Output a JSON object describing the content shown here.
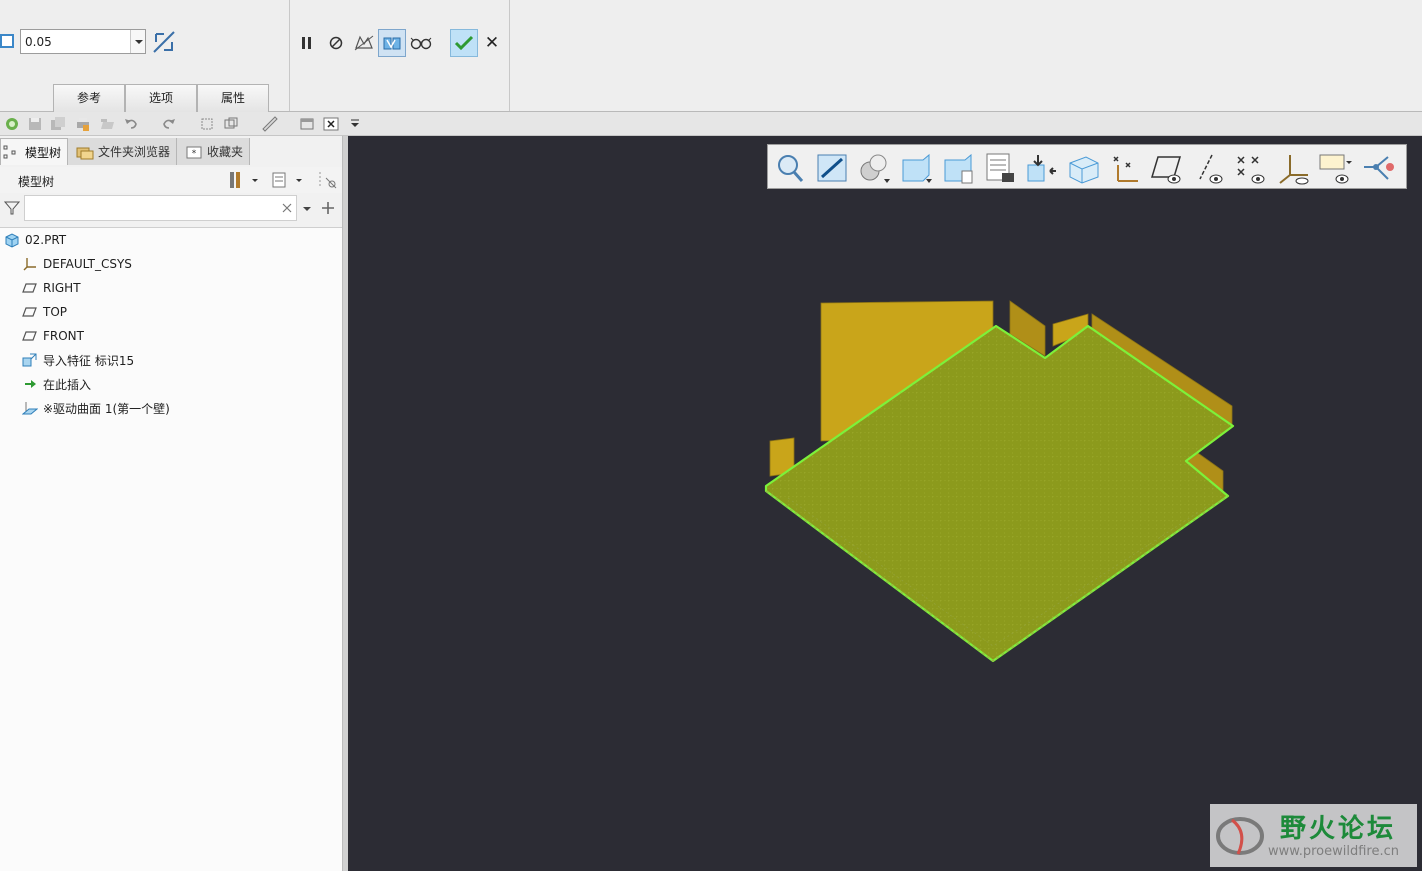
{
  "dashboard": {
    "thickness_value": "0.05",
    "tabs": [
      {
        "label": "参考"
      },
      {
        "label": "选项"
      },
      {
        "label": "属性"
      }
    ],
    "controls": [
      "pause-icon",
      "stop-icon",
      "no-preview-icon",
      "feature-preview-icon",
      "verify-preview-icon"
    ],
    "ok_icon": "check-icon",
    "cancel_label": "✕"
  },
  "quick_access": {
    "icons": [
      "regenerate-icon",
      "save-icon",
      "save-copy-icon",
      "print-icon",
      "open-icon",
      "undo-icon",
      "redo-icon",
      "datum-icon",
      "copy-icon",
      "measure-icon",
      "window-icon",
      "close-window-icon",
      "customize-icon"
    ]
  },
  "navigator": {
    "tabs": [
      {
        "label": "模型树",
        "icon": "tree-icon"
      },
      {
        "label": "文件夹浏览器",
        "icon": "folder-icon"
      },
      {
        "label": "收藏夹",
        "icon": "favorites-icon"
      }
    ],
    "header_label": "模型树",
    "filter_placeholder": "",
    "tree": [
      {
        "label": "02.PRT",
        "icon": "part-icon",
        "indent": 0
      },
      {
        "label": "DEFAULT_CSYS",
        "icon": "csys-icon",
        "indent": 1
      },
      {
        "label": "RIGHT",
        "icon": "datum-plane-icon",
        "indent": 1
      },
      {
        "label": "TOP",
        "icon": "datum-plane-icon",
        "indent": 1
      },
      {
        "label": "FRONT",
        "icon": "datum-plane-icon",
        "indent": 1
      },
      {
        "label": "导入特征 标识15",
        "icon": "import-feature-icon",
        "indent": 1
      },
      {
        "label": "在此插入",
        "icon": "insert-here-icon",
        "indent": 1
      },
      {
        "label": "※驱动曲面 1(第一个壁)",
        "icon": "driving-surface-icon",
        "indent": 1
      }
    ]
  },
  "view_toolbar": {
    "icons": [
      "zoom-icon",
      "repaint-icon",
      "display-style-icon",
      "saved-orientations-icon",
      "view-manager-icon",
      "spin-center-icon",
      "annotation-display-icon",
      "section-icon",
      "point-display-icon",
      "plane-display-icon",
      "axis-display-icon",
      "point-tag-icon",
      "csys-display-icon",
      "note-display-icon",
      "connector-icon"
    ]
  },
  "colors": {
    "viewport_bg": "#2c2c34",
    "sheet_fill": "#8c9a1c",
    "flange_fill": "#c9a51a",
    "highlight": "#7cf23a"
  },
  "watermark": {
    "title": "野火论坛",
    "url": "www.proewildfire.cn"
  }
}
